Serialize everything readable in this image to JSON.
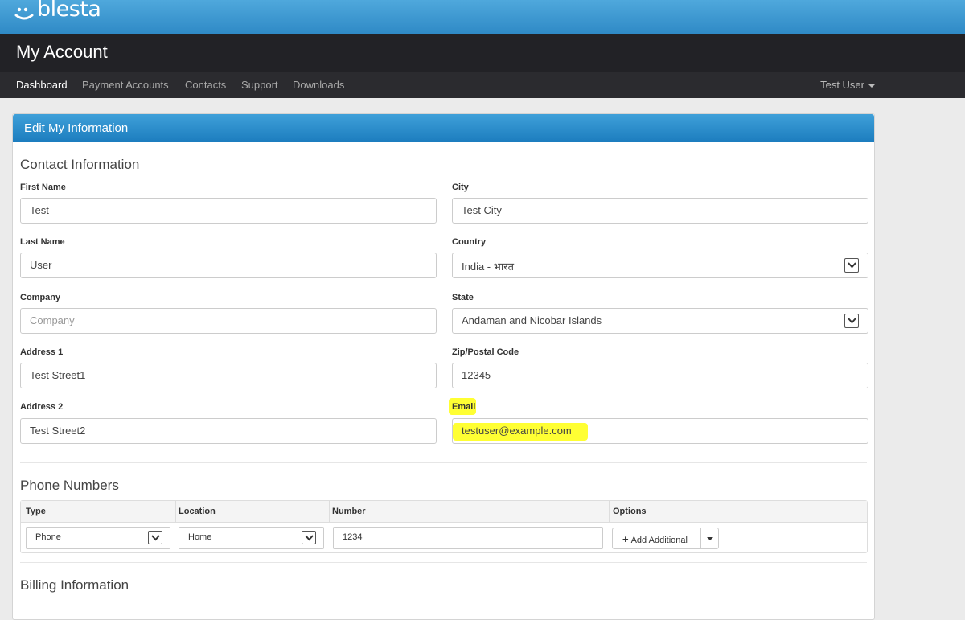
{
  "brand": {
    "logo_text": "blesta"
  },
  "header": {
    "title": "My Account"
  },
  "nav": {
    "items": [
      "Dashboard",
      "Payment Accounts",
      "Contacts",
      "Support",
      "Downloads"
    ],
    "user": "Test User"
  },
  "panel": {
    "title": "Edit My Information"
  },
  "contact": {
    "title": "Contact Information",
    "first_name": {
      "label": "First Name",
      "value": "Test"
    },
    "last_name": {
      "label": "Last Name",
      "value": "User"
    },
    "company": {
      "label": "Company",
      "placeholder": "Company"
    },
    "address1": {
      "label": "Address 1",
      "value": "Test Street1"
    },
    "address2": {
      "label": "Address 2",
      "value": "Test Street2"
    },
    "city": {
      "label": "City",
      "value": "Test City"
    },
    "country": {
      "label": "Country",
      "value": "India - भारत"
    },
    "state": {
      "label": "State",
      "value": "Andaman and Nicobar Islands"
    },
    "zip": {
      "label": "Zip/Postal Code",
      "value": "12345"
    },
    "email": {
      "label": "Email",
      "value": "testuser@example.com"
    }
  },
  "phone": {
    "title": "Phone Numbers",
    "columns": [
      "Type",
      "Location",
      "Number",
      "Options"
    ],
    "row": {
      "type": "Phone",
      "location": "Home",
      "number": "1234"
    },
    "add_label": "Add Additional"
  },
  "billing": {
    "title": "Billing Information"
  },
  "colors": {
    "accent": "#2f8ac6",
    "highlight": "#ffff33",
    "header_bg": "#222226"
  }
}
